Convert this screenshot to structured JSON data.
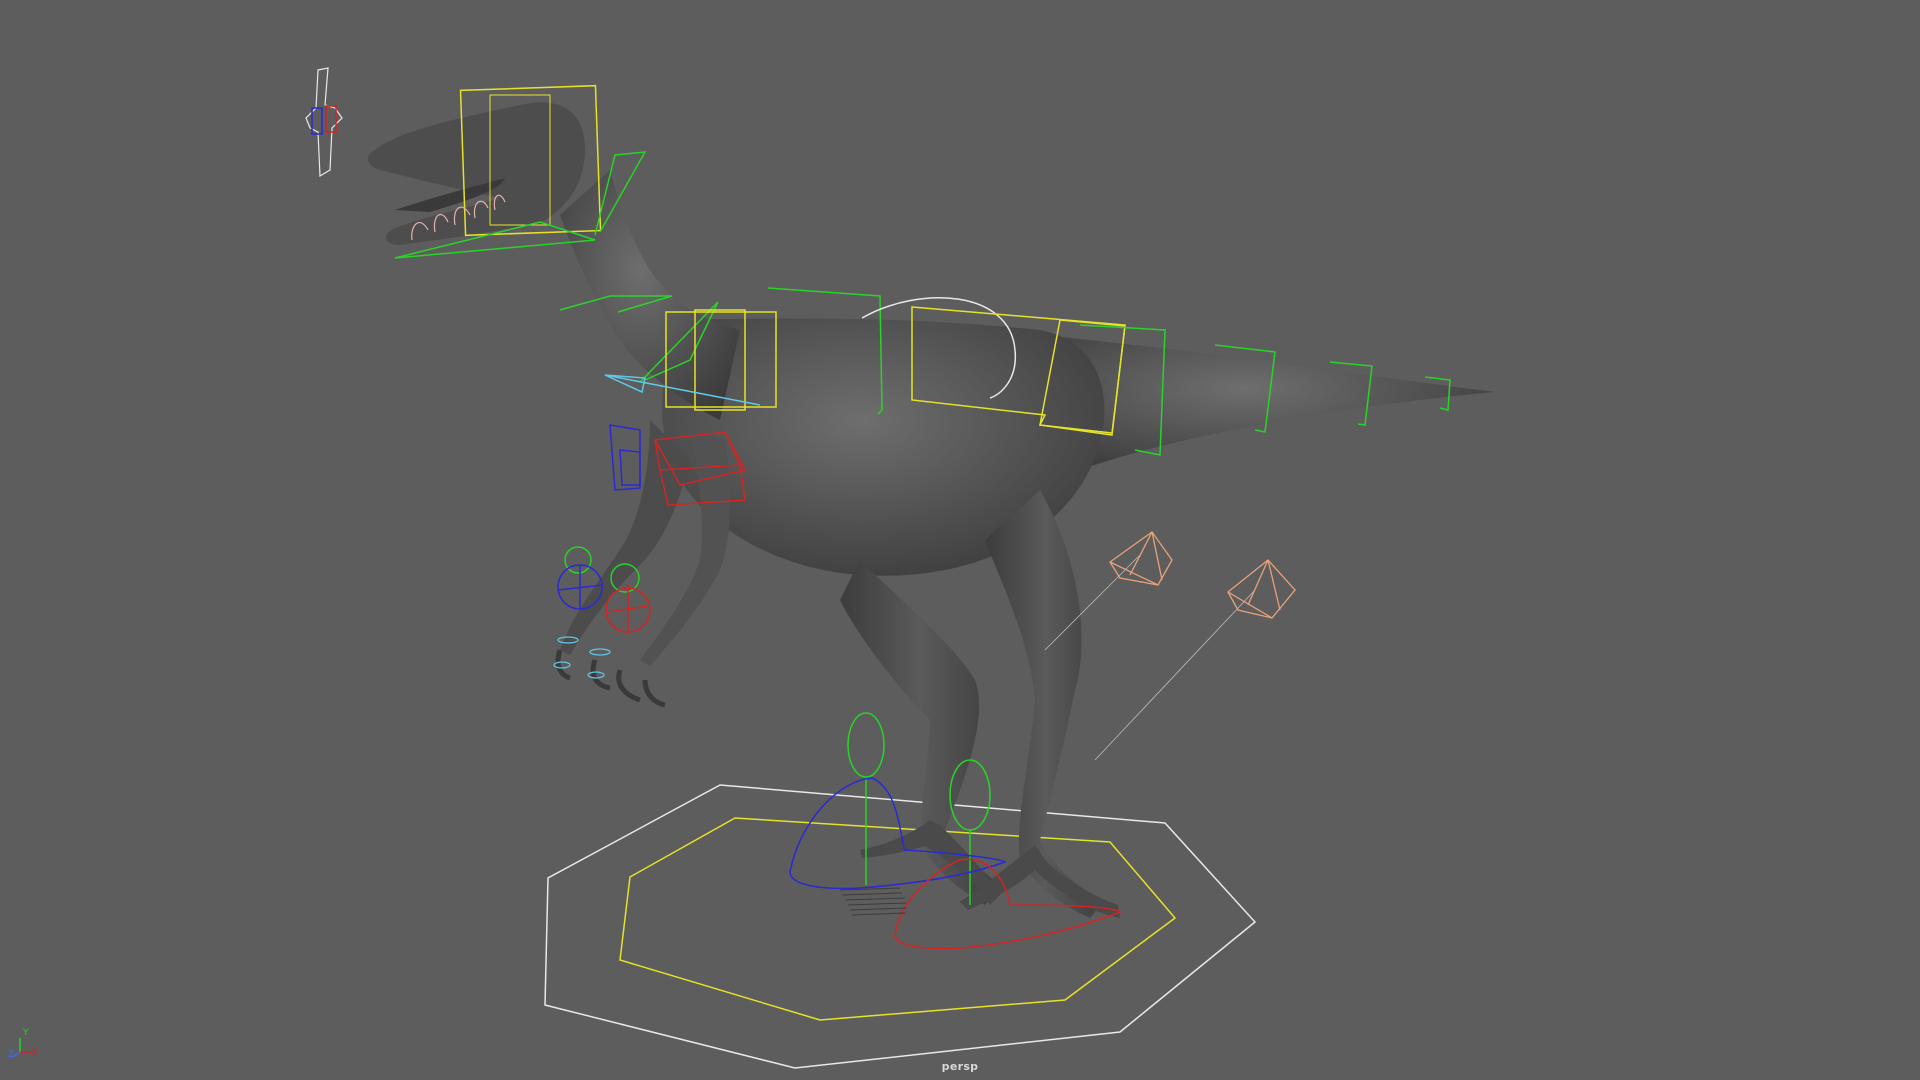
{
  "viewport": {
    "camera": "persp",
    "background": "#5d5d5d"
  },
  "axis_gizmo": {
    "x": "X",
    "y": "Y",
    "z": "Z"
  },
  "colors": {
    "control_yellow": "#e6e22a",
    "control_green": "#28d428",
    "control_red": "#d42424",
    "control_blue": "#2a2ad4",
    "control_cyan": "#5ec8e6",
    "control_white": "#e8e8e8",
    "control_peach": "#e8a27a",
    "mesh_grey": "#4a4a4a"
  }
}
